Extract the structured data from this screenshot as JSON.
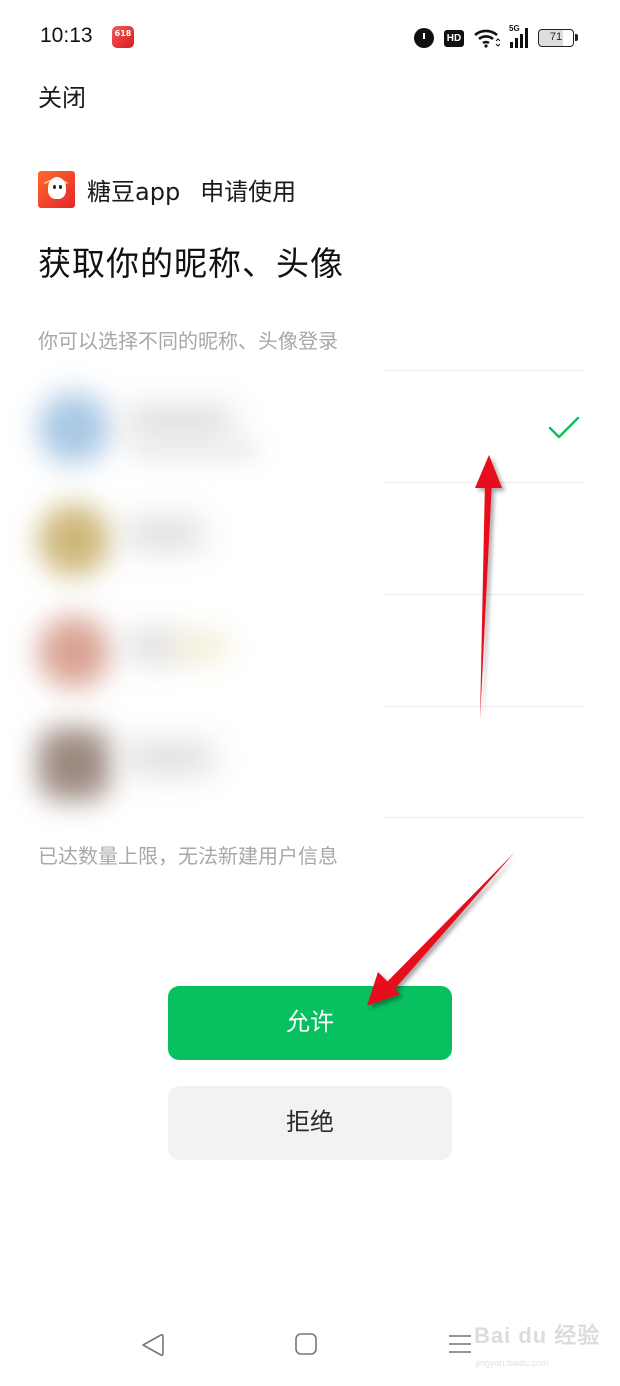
{
  "status_bar": {
    "time": "10:13",
    "notification_icon_label": "618",
    "battery_level": "71",
    "network_label": "5G",
    "hd_label": "HD"
  },
  "header": {
    "close_label": "关闭"
  },
  "app": {
    "name": "糖豆app",
    "request_text": "申请使用"
  },
  "page": {
    "title": "获取你的昵称、头像",
    "subtitle": "你可以选择不同的昵称、头像登录",
    "limit_note": "已达数量上限，无法新建用户信息"
  },
  "accounts": [
    {
      "avatar_color": "#a9c8e4",
      "selected": true
    },
    {
      "avatar_color": "#cdb77a",
      "selected": false
    },
    {
      "avatar_color": "#d9a394",
      "selected": false
    },
    {
      "avatar_color": "#9c8a80",
      "selected": false
    }
  ],
  "buttons": {
    "allow_label": "允许",
    "deny_label": "拒绝"
  },
  "colors": {
    "accent_green": "#07c160",
    "annotation_red": "#e8101a"
  },
  "watermark": {
    "brand": "Bai du 经验",
    "url": "jingyan.baidu.com"
  }
}
